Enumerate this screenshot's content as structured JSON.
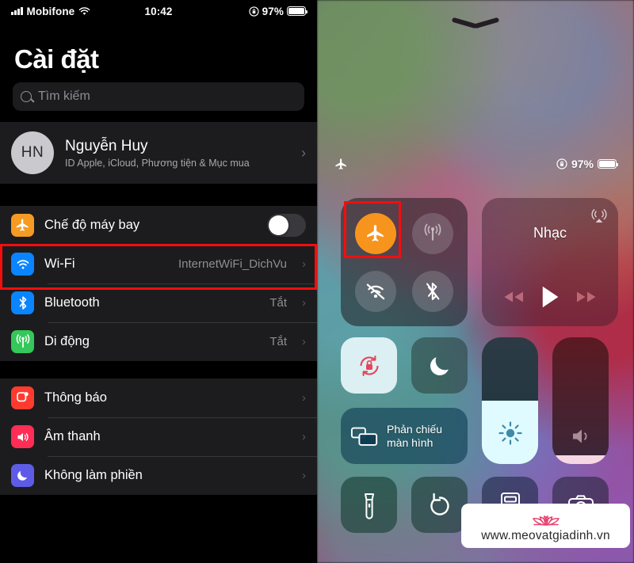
{
  "settings": {
    "status_bar": {
      "carrier": "Mobifone",
      "time": "10:42",
      "battery_percent": "97%",
      "signal_icon": "cellular-bars-icon",
      "wifi_icon": "wifi-icon",
      "rotation_lock_icon": "rotation-lock-icon",
      "battery_icon": "battery-icon"
    },
    "title": "Cài đặt",
    "search": {
      "placeholder": "Tìm kiếm",
      "icon": "search-icon"
    },
    "account": {
      "initials": "HN",
      "name": "Nguyễn Huy",
      "subtitle": "ID Apple, iCloud, Phương tiện & Mục mua",
      "chevron": "›"
    },
    "airplane_row": {
      "label": "Chế độ máy bay",
      "icon": "airplane-icon",
      "icon_color": "#f59a23",
      "toggle_state": "off",
      "highlight_color": "#f40d0d"
    },
    "rows": [
      {
        "label": "Wi-Fi",
        "value": "InternetWiFi_DichVu",
        "icon": "wifi-icon",
        "icon_color": "#0a84ff",
        "chevron": "›"
      },
      {
        "label": "Bluetooth",
        "value": "Tắt",
        "icon": "bluetooth-icon",
        "icon_color": "#0a84ff",
        "chevron": "›"
      },
      {
        "label": "Di động",
        "value": "Tắt",
        "icon": "cellular-antenna-icon",
        "icon_color": "#34c759",
        "chevron": "›"
      }
    ],
    "rows2": [
      {
        "label": "Thông báo",
        "value": "",
        "icon": "notifications-icon",
        "icon_color": "#ff3b30",
        "chevron": "›"
      },
      {
        "label": "Âm thanh",
        "value": "",
        "icon": "sound-icon",
        "icon_color": "#ff2d55",
        "chevron": "›"
      },
      {
        "label": "Không làm phiền",
        "value": "",
        "icon": "moon-icon",
        "icon_color": "#5e5ce6",
        "chevron": "›"
      }
    ]
  },
  "control_center": {
    "handle_icon": "chevron-down-handle-icon",
    "status": {
      "airplane_icon": "airplane-icon",
      "rotation_lock_icon": "rotation-lock-icon",
      "battery_percent": "97%",
      "battery_icon": "battery-icon"
    },
    "connectivity": {
      "airplane": {
        "name": "airplane-mode-button",
        "icon": "airplane-icon",
        "state": "on",
        "active_color": "#f7941d"
      },
      "cellular": {
        "name": "cellular-data-button",
        "icon": "cellular-antenna-icon",
        "state": "off"
      },
      "wifi": {
        "name": "wifi-button",
        "icon": "wifi-off-icon",
        "state": "off"
      },
      "bluetooth": {
        "name": "bluetooth-button",
        "icon": "bluetooth-off-icon",
        "state": "off"
      },
      "highlight_color": "#f40d0d"
    },
    "music": {
      "title": "Nhạc",
      "airplay_icon": "airplay-icon",
      "prev_icon": "rewind-icon",
      "play_icon": "play-icon",
      "next_icon": "fast-forward-icon"
    },
    "rotation_lock": {
      "icon": "rotation-lock-icon",
      "state": "on"
    },
    "do_not_disturb": {
      "icon": "moon-icon",
      "state": "off"
    },
    "screen_mirroring": {
      "label_line1": "Phản chiếu",
      "label_line2": "màn hình",
      "icon": "screen-mirroring-icon"
    },
    "brightness": {
      "icon": "brightness-icon",
      "level_percent": 50
    },
    "volume": {
      "icon": "volume-icon",
      "level_percent": 7
    },
    "tools": [
      {
        "name": "flashlight-button",
        "icon": "flashlight-icon"
      },
      {
        "name": "timer-button",
        "icon": "timer-icon"
      },
      {
        "name": "calculator-button",
        "icon": "calculator-icon"
      },
      {
        "name": "camera-button",
        "icon": "camera-icon"
      }
    ]
  },
  "watermark": {
    "url": "www.meovatgiadinh.vn",
    "logo_icon": "lotus-logo-icon",
    "logo_color": "#e8436f"
  }
}
